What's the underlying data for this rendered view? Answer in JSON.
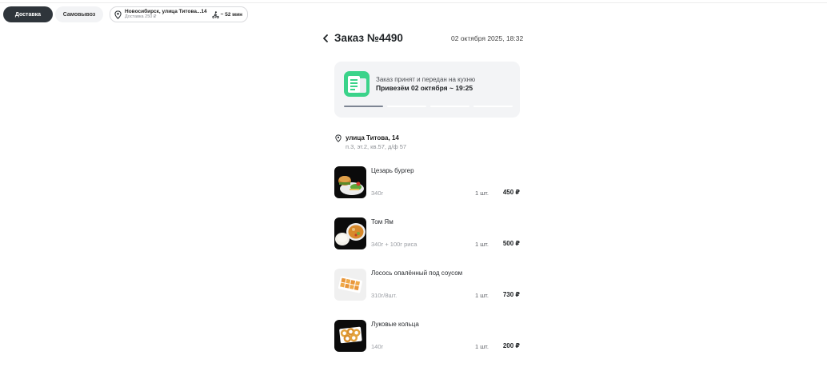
{
  "topbar": {
    "delivery_label": "Доставка",
    "pickup_label": "Самовывоз",
    "address": "Новосибирск, улица Титова...14",
    "delivery_cost": "Доставка 250 ₽",
    "eta": "~ 52 мин"
  },
  "order": {
    "title": "Заказ №4490",
    "datetime": "02 октября 2025, 18:32"
  },
  "status": {
    "line1": "Заказ принят и передан на кухню",
    "line2": "Привезём 02 октября ~ 19:25",
    "steps_total": 4,
    "steps_done": 1
  },
  "address": {
    "street": "улица Титова, 14",
    "details": "п.3, эт.2, кв.57, д/ф 57"
  },
  "items": [
    {
      "name": "Цезарь бургер",
      "weight": "340г",
      "qty": "1 шт.",
      "price": "450 ₽"
    },
    {
      "name": "Том Ям",
      "weight": "340г + 100г риса",
      "qty": "1 шт.",
      "price": "500 ₽"
    },
    {
      "name": "Лосось опалённый под соусом",
      "weight": "310г/8шт.",
      "qty": "1 шт.",
      "price": "730 ₽"
    },
    {
      "name": "Луковые кольца",
      "weight": "140г",
      "qty": "1 шт.",
      "price": "200 ₽"
    }
  ],
  "icons": {
    "back": "chevron-left-icon",
    "pin": "location-pin-icon",
    "eta": "courier-icon",
    "status": "receipt-icon"
  },
  "colors": {
    "accent_green": "#3bd38a",
    "dark_pill": "#2f353b",
    "card_bg": "#f3f4f6"
  }
}
